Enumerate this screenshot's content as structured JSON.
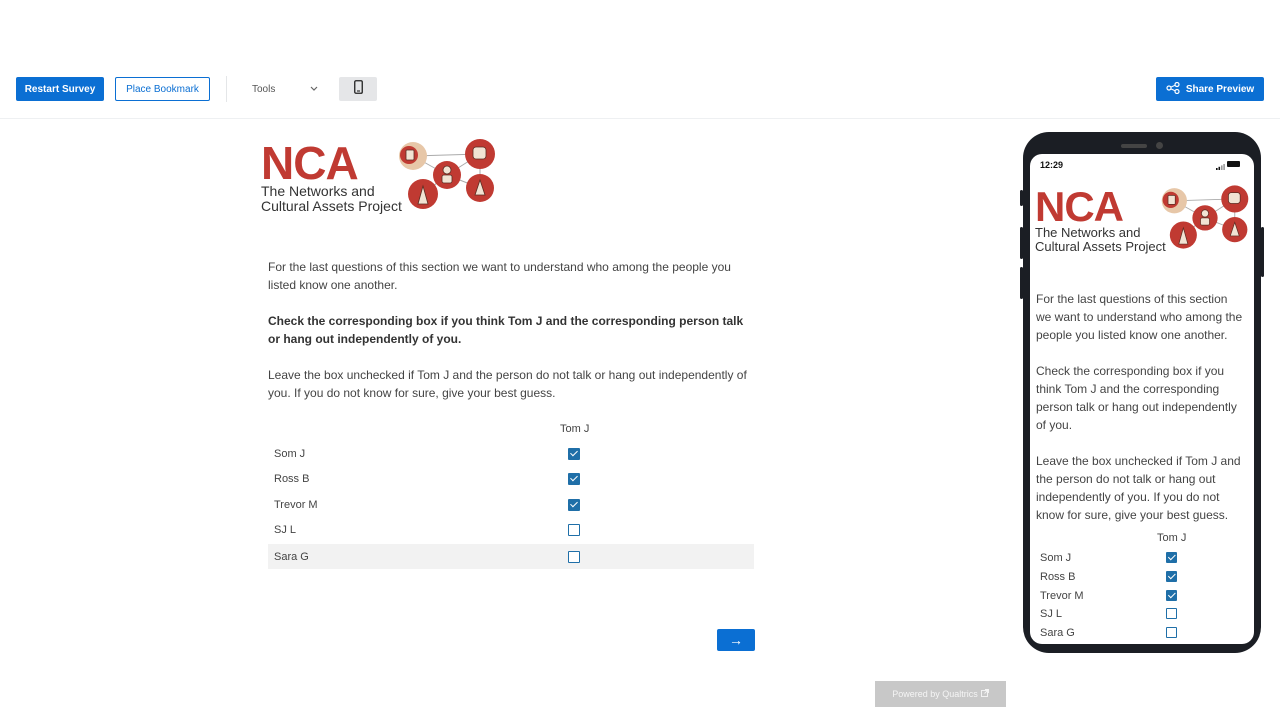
{
  "toolbar": {
    "restart_label": "Restart Survey",
    "bookmark_label": "Place Bookmark",
    "tools_label": "Tools",
    "share_label": "Share Preview"
  },
  "logo": {
    "acronym": "NCA",
    "tagline_line1": "The Networks and",
    "tagline_line2": "Cultural Assets Project"
  },
  "question": {
    "intro": "For the last questions of this section we want to understand who among the people you listed know one another.",
    "instruction": "Check the corresponding box if you think Tom J and the corresponding person talk or hang out independently of you.",
    "note": "Leave the box unchecked if Tom J and the person do not talk or hang out independently of you. If you do not know for sure, give your best guess.",
    "column_header": "Tom J",
    "rows": [
      {
        "label": "Som J",
        "checked": true
      },
      {
        "label": "Ross B",
        "checked": true
      },
      {
        "label": "Trevor M",
        "checked": true
      },
      {
        "label": "SJ L",
        "checked": false
      },
      {
        "label": "Sara G",
        "checked": false
      }
    ]
  },
  "next_button": "→",
  "powered_by": "Powered by Qualtrics",
  "phone": {
    "time": "12:29"
  },
  "colors": {
    "accent": "#0b6fd3",
    "checkbox": "#1f6fa8",
    "brand_red": "#c03a32"
  }
}
